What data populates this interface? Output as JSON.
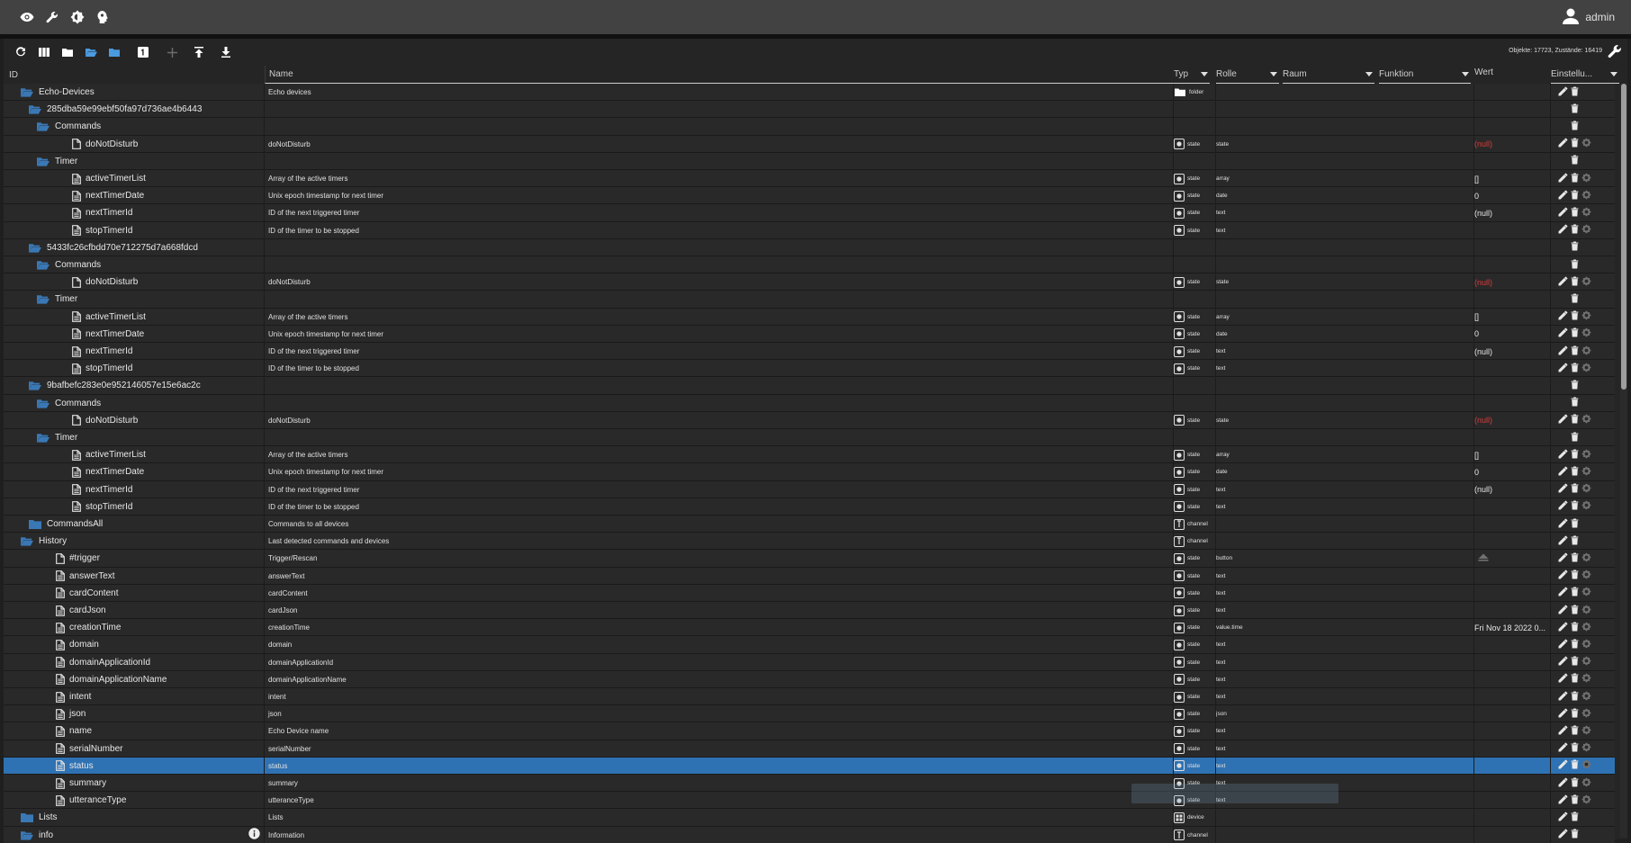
{
  "appbar": {
    "icons": [
      "eye-icon",
      "wrench-icon",
      "brightness-icon",
      "expert-head-icon"
    ],
    "user": "admin"
  },
  "toolbar": {
    "icons": [
      "refresh-icon",
      "columns-icon",
      "folder-closed-icon",
      "folder-open-icon",
      "folder-blue-icon",
      "number-one-icon",
      "plus-icon",
      "upload-icon",
      "download-icon"
    ],
    "stats": "Objekte: 17723, Zustände: 16419"
  },
  "columns": {
    "id": "ID",
    "name": "Name",
    "type": "Typ",
    "role": "Rolle",
    "room": "Raum",
    "function": "Funktion",
    "value": "Wert",
    "settings": "Einstellu..."
  },
  "rows": [
    {
      "level": 1,
      "kind": "folder-open",
      "id": "Echo-Devices",
      "name": "Echo devices",
      "type": "folder",
      "typeIcon": "folder",
      "role": "",
      "value": "",
      "actions": "edit-del"
    },
    {
      "level": 2,
      "kind": "folder-open",
      "id": "285dba59e99ebf50fa97d736ae4b6443",
      "name": "",
      "type": "",
      "typeIcon": "",
      "role": "",
      "value": "",
      "actions": "del"
    },
    {
      "level": 3,
      "kind": "folder-open",
      "id": "Commands",
      "name": "",
      "type": "",
      "typeIcon": "",
      "role": "",
      "value": "",
      "actions": "del"
    },
    {
      "level": 4,
      "kind": "file",
      "id": "doNotDisturb",
      "name": "doNotDisturb",
      "type": "state",
      "typeIcon": "state",
      "role": "state",
      "value": "(null)",
      "valueNull": true,
      "actions": "edit-del-gear"
    },
    {
      "level": 3,
      "kind": "folder-open",
      "id": "Timer",
      "name": "",
      "type": "",
      "typeIcon": "",
      "role": "",
      "value": "",
      "actions": "del"
    },
    {
      "level": 4,
      "kind": "file-lines",
      "id": "activeTimerList",
      "name": "Array of the active timers",
      "type": "state",
      "typeIcon": "state",
      "role": "array",
      "value": "[]",
      "actions": "edit-del-gear"
    },
    {
      "level": 4,
      "kind": "file-lines",
      "id": "nextTimerDate",
      "name": "Unix epoch timestamp for next timer",
      "type": "state",
      "typeIcon": "state",
      "role": "date",
      "value": "0",
      "actions": "edit-del-gear"
    },
    {
      "level": 4,
      "kind": "file-lines",
      "id": "nextTimerId",
      "name": "ID of the next triggered timer",
      "type": "state",
      "typeIcon": "state",
      "role": "text",
      "value": "(null)",
      "actions": "edit-del-gear"
    },
    {
      "level": 4,
      "kind": "file-lines",
      "id": "stopTimerId",
      "name": "ID of the timer to be stopped",
      "type": "state",
      "typeIcon": "state",
      "role": "text",
      "value": "",
      "actions": "edit-del-gear"
    },
    {
      "level": 2,
      "kind": "folder-open",
      "id": "5433fc26cfbdd70e712275d7a668fdcd",
      "name": "",
      "type": "",
      "typeIcon": "",
      "role": "",
      "value": "",
      "actions": "del"
    },
    {
      "level": 3,
      "kind": "folder-open",
      "id": "Commands",
      "name": "",
      "type": "",
      "typeIcon": "",
      "role": "",
      "value": "",
      "actions": "del"
    },
    {
      "level": 4,
      "kind": "file",
      "id": "doNotDisturb",
      "name": "doNotDisturb",
      "type": "state",
      "typeIcon": "state",
      "role": "state",
      "value": "(null)",
      "valueNull": true,
      "actions": "edit-del-gear"
    },
    {
      "level": 3,
      "kind": "folder-open",
      "id": "Timer",
      "name": "",
      "type": "",
      "typeIcon": "",
      "role": "",
      "value": "",
      "actions": "del"
    },
    {
      "level": 4,
      "kind": "file-lines",
      "id": "activeTimerList",
      "name": "Array of the active timers",
      "type": "state",
      "typeIcon": "state",
      "role": "array",
      "value": "[]",
      "actions": "edit-del-gear"
    },
    {
      "level": 4,
      "kind": "file-lines",
      "id": "nextTimerDate",
      "name": "Unix epoch timestamp for next timer",
      "type": "state",
      "typeIcon": "state",
      "role": "date",
      "value": "0",
      "actions": "edit-del-gear"
    },
    {
      "level": 4,
      "kind": "file-lines",
      "id": "nextTimerId",
      "name": "ID of the next triggered timer",
      "type": "state",
      "typeIcon": "state",
      "role": "text",
      "value": "(null)",
      "actions": "edit-del-gear"
    },
    {
      "level": 4,
      "kind": "file-lines",
      "id": "stopTimerId",
      "name": "ID of the timer to be stopped",
      "type": "state",
      "typeIcon": "state",
      "role": "text",
      "value": "",
      "actions": "edit-del-gear"
    },
    {
      "level": 2,
      "kind": "folder-open",
      "id": "9bafbefc283e0e952146057e15e6ac2c",
      "name": "",
      "type": "",
      "typeIcon": "",
      "role": "",
      "value": "",
      "actions": "del"
    },
    {
      "level": 3,
      "kind": "folder-open",
      "id": "Commands",
      "name": "",
      "type": "",
      "typeIcon": "",
      "role": "",
      "value": "",
      "actions": "del"
    },
    {
      "level": 4,
      "kind": "file",
      "id": "doNotDisturb",
      "name": "doNotDisturb",
      "type": "state",
      "typeIcon": "state",
      "role": "state",
      "value": "(null)",
      "valueNull": true,
      "actions": "edit-del-gear"
    },
    {
      "level": 3,
      "kind": "folder-open",
      "id": "Timer",
      "name": "",
      "type": "",
      "typeIcon": "",
      "role": "",
      "value": "",
      "actions": "del"
    },
    {
      "level": 4,
      "kind": "file-lines",
      "id": "activeTimerList",
      "name": "Array of the active timers",
      "type": "state",
      "typeIcon": "state",
      "role": "array",
      "value": "[]",
      "actions": "edit-del-gear"
    },
    {
      "level": 4,
      "kind": "file-lines",
      "id": "nextTimerDate",
      "name": "Unix epoch timestamp for next timer",
      "type": "state",
      "typeIcon": "state",
      "role": "date",
      "value": "0",
      "actions": "edit-del-gear"
    },
    {
      "level": 4,
      "kind": "file-lines",
      "id": "nextTimerId",
      "name": "ID of the next triggered timer",
      "type": "state",
      "typeIcon": "state",
      "role": "text",
      "value": "(null)",
      "actions": "edit-del-gear"
    },
    {
      "level": 4,
      "kind": "file-lines",
      "id": "stopTimerId",
      "name": "ID of the timer to be stopped",
      "type": "state",
      "typeIcon": "state",
      "role": "text",
      "value": "",
      "actions": "edit-del-gear"
    },
    {
      "level": 2,
      "kind": "folder-closed",
      "id": "CommandsAll",
      "name": "Commands to all devices",
      "type": "channel",
      "typeIcon": "channel",
      "role": "",
      "value": "",
      "actions": "edit-del"
    },
    {
      "level": 1,
      "kind": "folder-open",
      "id": "History",
      "name": "Last detected commands and devices",
      "type": "channel",
      "typeIcon": "channel",
      "role": "",
      "value": "",
      "actions": "edit-del"
    },
    {
      "level": 2,
      "kind": "file",
      "id": "#trigger",
      "name": "Trigger/Rescan",
      "type": "state",
      "typeIcon": "state",
      "role": "button",
      "value": "",
      "valueButton": true,
      "actions": "edit-del-gear"
    },
    {
      "level": 2,
      "kind": "file-lines",
      "id": "answerText",
      "name": "answerText",
      "type": "state",
      "typeIcon": "state",
      "role": "text",
      "value": "",
      "actions": "edit-del-gear"
    },
    {
      "level": 2,
      "kind": "file-lines",
      "id": "cardContent",
      "name": "cardContent",
      "type": "state",
      "typeIcon": "state",
      "role": "text",
      "value": "",
      "actions": "edit-del-gear"
    },
    {
      "level": 2,
      "kind": "file-lines",
      "id": "cardJson",
      "name": "cardJson",
      "type": "state",
      "typeIcon": "state",
      "role": "text",
      "value": "",
      "actions": "edit-del-gear"
    },
    {
      "level": 2,
      "kind": "file-lines",
      "id": "creationTime",
      "name": "creationTime",
      "type": "state",
      "typeIcon": "state",
      "role": "value.time",
      "value": "Fri Nov 18 2022 0...",
      "actions": "edit-del-gear"
    },
    {
      "level": 2,
      "kind": "file-lines",
      "id": "domain",
      "name": "domain",
      "type": "state",
      "typeIcon": "state",
      "role": "text",
      "value": "",
      "actions": "edit-del-gear"
    },
    {
      "level": 2,
      "kind": "file-lines",
      "id": "domainApplicationId",
      "name": "domainApplicationId",
      "type": "state",
      "typeIcon": "state",
      "role": "text",
      "value": "",
      "actions": "edit-del-gear"
    },
    {
      "level": 2,
      "kind": "file-lines",
      "id": "domainApplicationName",
      "name": "domainApplicationName",
      "type": "state",
      "typeIcon": "state",
      "role": "text",
      "value": "",
      "actions": "edit-del-gear"
    },
    {
      "level": 2,
      "kind": "file-lines",
      "id": "intent",
      "name": "intent",
      "type": "state",
      "typeIcon": "state",
      "role": "text",
      "value": "",
      "actions": "edit-del-gear"
    },
    {
      "level": 2,
      "kind": "file-lines",
      "id": "json",
      "name": "json",
      "type": "state",
      "typeIcon": "state",
      "role": "json",
      "value": "",
      "actions": "edit-del-gear"
    },
    {
      "level": 2,
      "kind": "file-lines",
      "id": "name",
      "name": "Echo Device name",
      "type": "state",
      "typeIcon": "state",
      "role": "text",
      "value": "",
      "actions": "edit-del-gear"
    },
    {
      "level": 2,
      "kind": "file-lines",
      "id": "serialNumber",
      "name": "serialNumber",
      "type": "state",
      "typeIcon": "state",
      "role": "text",
      "value": "",
      "actions": "edit-del-gear"
    },
    {
      "level": 2,
      "kind": "file-lines",
      "id": "status",
      "name": "status",
      "type": "state",
      "typeIcon": "state",
      "role": "text",
      "value": "",
      "actions": "edit-del-gear",
      "selected": true
    },
    {
      "level": 2,
      "kind": "file-lines",
      "id": "summary",
      "name": "summary",
      "type": "state",
      "typeIcon": "state",
      "role": "text",
      "value": "",
      "actions": "edit-del-gear"
    },
    {
      "level": 2,
      "kind": "file-lines",
      "id": "utteranceType",
      "name": "utteranceType",
      "type": "state",
      "typeIcon": "state",
      "role": "text",
      "value": "",
      "actions": "edit-del-gear"
    },
    {
      "level": 1,
      "kind": "folder-closed",
      "id": "Lists",
      "name": "Lists",
      "type": "device",
      "typeIcon": "device",
      "role": "",
      "value": "",
      "actions": "edit-del"
    },
    {
      "level": 1,
      "kind": "folder-open",
      "id": "info",
      "name": "Information",
      "type": "channel",
      "typeIcon": "channel",
      "role": "",
      "value": "",
      "actions": "edit-del",
      "infoIcon": true
    }
  ],
  "colors": {
    "appbar": "#424242",
    "folder": "#3a78b5",
    "selected": "#2f72b3",
    "null": "#d93a3a"
  }
}
